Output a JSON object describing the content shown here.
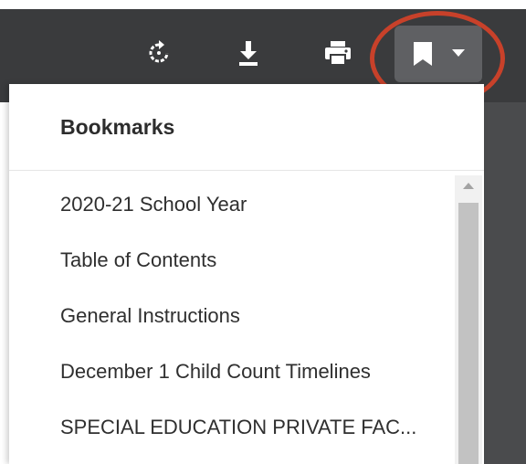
{
  "toolbar": {
    "buttons": [
      {
        "name": "rotate",
        "icon": "rotate-icon"
      },
      {
        "name": "download",
        "icon": "download-icon"
      },
      {
        "name": "print",
        "icon": "print-icon"
      },
      {
        "name": "bookmark",
        "icon": "bookmark-icon",
        "active": true
      }
    ],
    "highlight_color": "#c8412a"
  },
  "bookmarks_panel": {
    "title": "Bookmarks",
    "items": [
      "2020-21 School Year",
      "Table of Contents",
      "General Instructions",
      "December 1 Child Count Timelines",
      "SPECIAL EDUCATION PRIVATE FAC..."
    ]
  }
}
